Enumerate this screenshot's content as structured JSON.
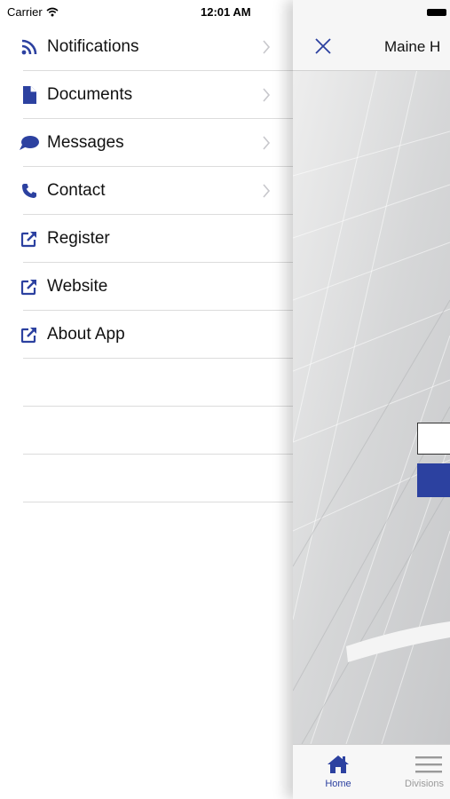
{
  "status_bar": {
    "carrier": "Carrier",
    "time": "12:01 AM"
  },
  "menu": {
    "items": [
      {
        "label": "Notifications",
        "icon": "rss-icon",
        "has_chevron": true
      },
      {
        "label": "Documents",
        "icon": "document-icon",
        "has_chevron": true
      },
      {
        "label": "Messages",
        "icon": "speech-bubble-icon",
        "has_chevron": true
      },
      {
        "label": "Contact",
        "icon": "phone-icon",
        "has_chevron": true
      },
      {
        "label": "Register",
        "icon": "external-link-icon",
        "has_chevron": false
      },
      {
        "label": "Website",
        "icon": "external-link-icon",
        "has_chevron": false
      },
      {
        "label": "About App",
        "icon": "external-link-icon",
        "has_chevron": false
      }
    ]
  },
  "main": {
    "title": "Maine H",
    "tabs": [
      {
        "label": "Home",
        "icon": "home-icon",
        "active": true
      },
      {
        "label": "Divisions",
        "icon": "menu-lines-icon",
        "active": false
      }
    ]
  },
  "colors": {
    "accent": "#2c41a0",
    "text": "#111111",
    "separator": "#dcdcdc",
    "chevron": "#c7c7cc",
    "inactive_tab": "#9a9a9a"
  }
}
